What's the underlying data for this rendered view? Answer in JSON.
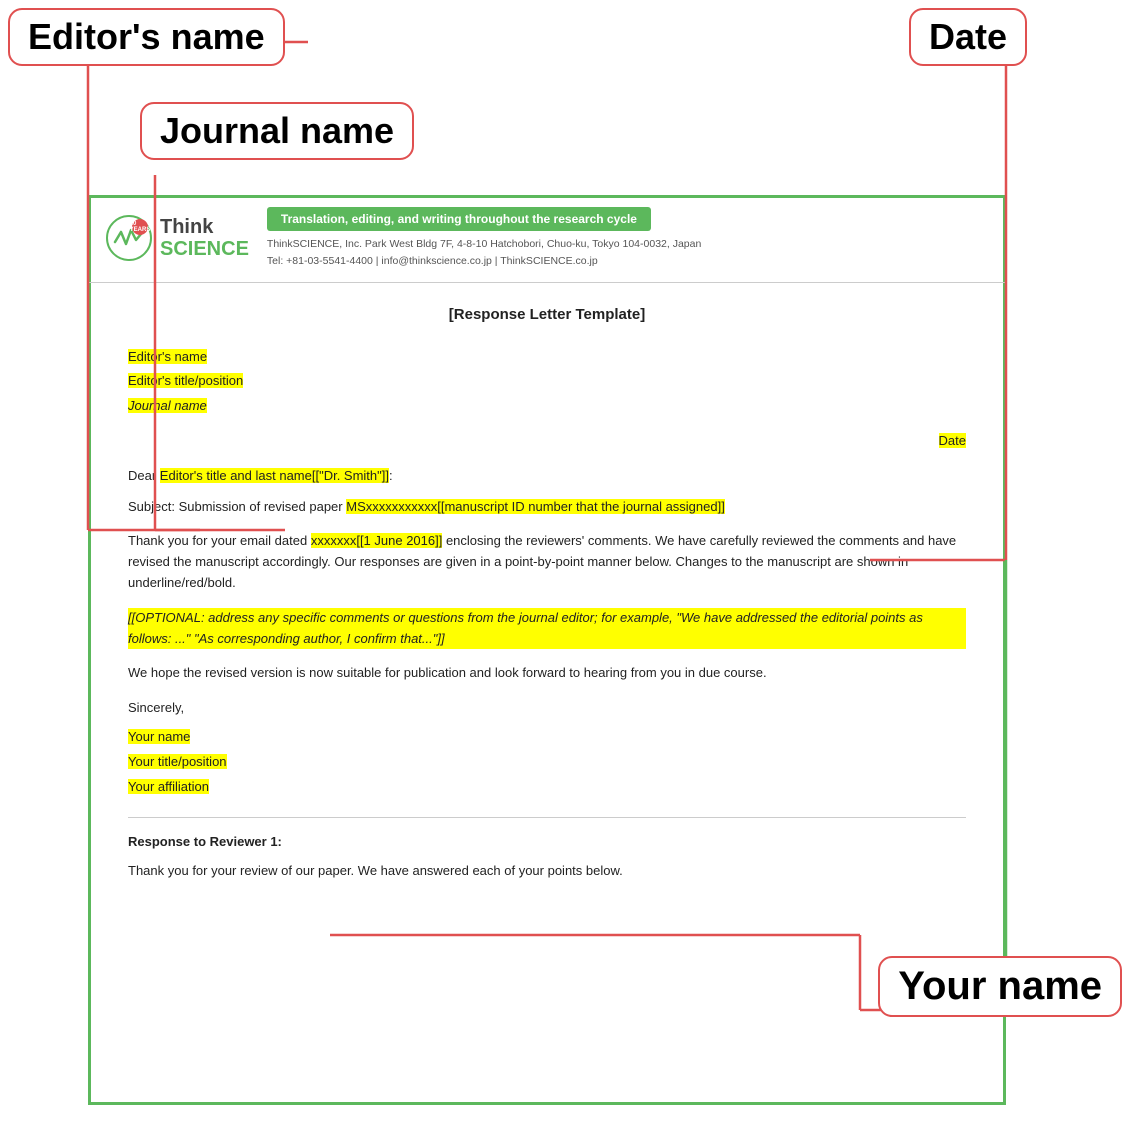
{
  "labels": {
    "editors_name": "Editor's name",
    "date": "Date",
    "journal_name": "Journal name",
    "your_name": "Your name"
  },
  "header": {
    "tagline": "Translation, editing, and writing throughout the research cycle",
    "company": "ThinkSCIENCE",
    "address": "ThinkSCIENCE, Inc.  Park West Bldg 7F, 4-8-10 Hatchobori, Chuo-ku, Tokyo 104-0032, Japan",
    "contact": "Tel: +81-03-5541-4400 | info@thinkscience.co.jp | ThinkSCIENCE.co.jp",
    "logo_years": "10 YEARS",
    "logo_name": "Think SCIENCE"
  },
  "letter": {
    "title": "[Response Letter Template]",
    "field_editors_name": "Editor's name",
    "field_editors_title": "Editor's title/position",
    "field_journal_name": "Journal name",
    "field_date": "Date",
    "dear": "Dear ",
    "dear_highlight": "Editor's title and last name[[\"Dr. Smith\"]]",
    "dear_end": ":",
    "subject_start": "Subject:  Submission of revised paper  ",
    "subject_highlight": "MSxxxxxxxxxxx[[manuscript ID number that the journal assigned]]",
    "body1_start": "Thank you for your email dated ",
    "body1_highlight": "xxxxxxx[[1 June 2016]]",
    "body1_end": " enclosing the reviewers' comments. We have carefully reviewed the comments and have revised the manuscript accordingly. Our responses are given in a point-by-point manner below. Changes to the manuscript are shown in underline/red/bold.",
    "optional": "[[OPTIONAL: address any specific comments or questions from the journal editor; for example, \"We have addressed the editorial points as follows: ...\" \"As corresponding author, I confirm that...\"]]",
    "body2": "We hope the revised version is now suitable for publication and look forward to hearing from you in due course.",
    "sincerely": "Sincerely,",
    "your_name": "Your name",
    "your_title": "Your title/position",
    "your_affiliation": "Your affiliation",
    "response_title": "Response to Reviewer 1:",
    "response_body": "Thank you for your review of our paper. We have answered each of your points below."
  }
}
